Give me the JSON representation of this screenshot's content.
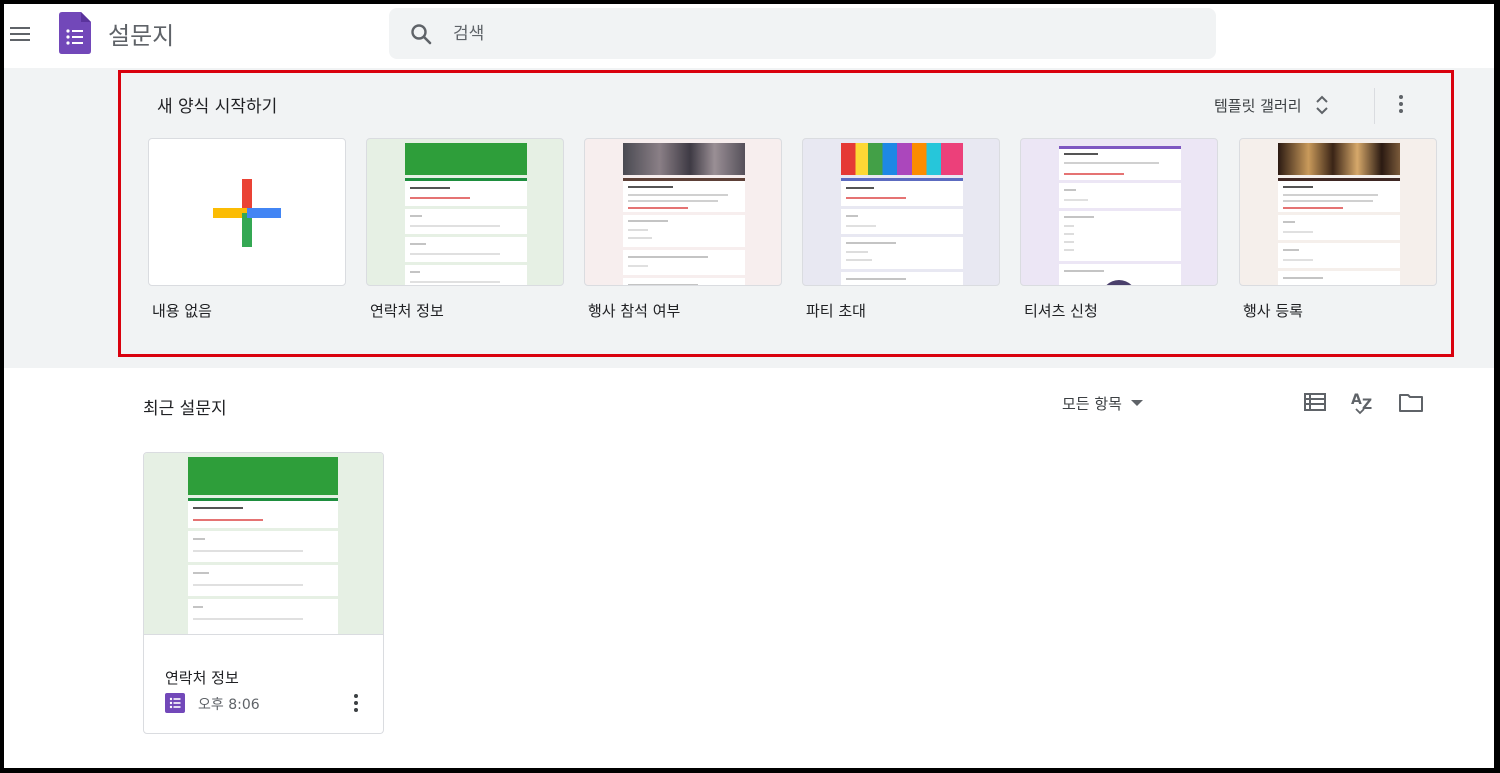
{
  "header": {
    "app_title": "설문지",
    "menu_icon": "hamburger-menu-icon",
    "logo_icon": "forms-logo-icon",
    "search": {
      "placeholder": "검색",
      "value": "",
      "icon": "search-icon"
    }
  },
  "templates": {
    "section_title": "새 양식 시작하기",
    "gallery_label": "템플릿 갤러리",
    "gallery_icon": "unfold-icon",
    "more_icon": "more-vert-icon",
    "items": [
      {
        "label": "내용 없음",
        "icon": "plus-icon"
      },
      {
        "label": "연락처 정보",
        "accent": "#1e8e3e",
        "bg": "#e6f0e4"
      },
      {
        "label": "행사 참석 여부",
        "accent": "#5d4037",
        "bg": "#f7eeee"
      },
      {
        "label": "파티 초대",
        "accent": "#5c6bc0",
        "bg": "#e8e8f2"
      },
      {
        "label": "티셔츠 신청",
        "accent": "#7e57c2",
        "bg": "#ece6f5"
      },
      {
        "label": "행사 등록",
        "accent": "#3e2723",
        "bg": "#f5efeb"
      }
    ]
  },
  "recent": {
    "section_title": "최근 설문지",
    "owner_filter": "모든 항목",
    "view_icons": [
      "list-view-icon",
      "sort-az-icon",
      "folder-icon"
    ],
    "items": [
      {
        "name": "연락처 정보",
        "time": "오후 8:06",
        "icon": "forms-icon",
        "more_icon": "more-vert-icon"
      }
    ]
  },
  "colors": {
    "highlight_border": "#d9000d",
    "forms_purple": "#7248b9",
    "band_background": "#f1f3f4"
  }
}
